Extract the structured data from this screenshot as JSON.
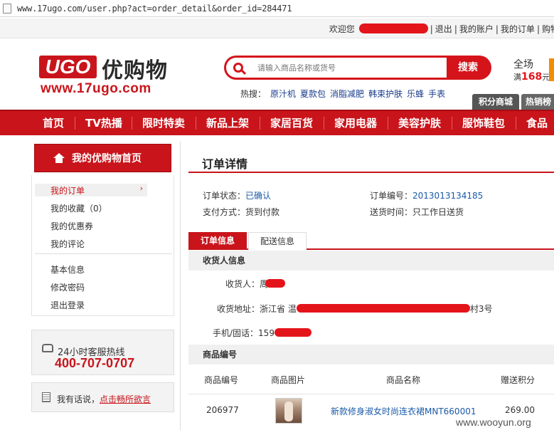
{
  "urlbar": {
    "url": "www.17ugo.com/user.php?act=order_detail&order_id=284471"
  },
  "topbar": {
    "welcome": "欢迎您",
    "logout": "退出",
    "account": "我的账户",
    "orders": "我的订单",
    "cart": "购物"
  },
  "header": {
    "logo_badge": "UGO",
    "logo_cn": "优购物",
    "logo_domain": "www.17ugo.com",
    "search_placeholder": "请输入商品名称或货号",
    "search_button": "搜索",
    "hot_label": "热搜：",
    "hot_terms": [
      "原汁机",
      "夏款包",
      "消脂减肥",
      "韩束护肤",
      "乐蜂",
      "手表"
    ],
    "promo_line1": "全场",
    "promo_line2_prefix": "满",
    "promo_amount": "168",
    "promo_line2_suffix": "元",
    "tab_points": "积分商城",
    "tab_hot": "热销榜"
  },
  "nav": [
    "首页",
    "TV热播",
    "限时特卖",
    "新品上架",
    "家居百货",
    "家用电器",
    "美容护肤",
    "服饰鞋包",
    "食品"
  ],
  "sidebar": {
    "home": "我的优购物首页",
    "menu": [
      {
        "label": "我的订单",
        "active": true
      },
      {
        "label": "我的收藏（0）"
      },
      {
        "label": "我的优惠券"
      },
      {
        "label": "我的评论"
      },
      {
        "label": "基本信息"
      },
      {
        "label": "修改密码"
      },
      {
        "label": "退出登录"
      }
    ],
    "hotline_title": "24小时客服热线",
    "hotline_number": "400-707-0707",
    "feedback_prefix": "我有话说，",
    "feedback_link": "点击畅所欲言"
  },
  "order": {
    "title": "订单详情",
    "status_label": "订单状态：",
    "status_value": "已确认",
    "number_label": "订单编号：",
    "number_value": "2013013134185",
    "payment_label": "支付方式：",
    "payment_value": "货到付款",
    "delivery_label": "送货时间：",
    "delivery_value": "只工作日送货",
    "tab_info": "订单信息",
    "tab_shipping": "配送信息",
    "receiver_section": "收货人信息",
    "receiver_label": "收货人：",
    "receiver_value": "周",
    "address_label": "收货地址：",
    "address_prefix": "浙江省 温",
    "address_suffix": "村3号",
    "phone_label": "手机/固话：",
    "phone_value": "159",
    "goods_section": "商品编号",
    "columns": [
      "商品编号",
      "商品图片",
      "商品名称",
      "赠送积分"
    ],
    "items": [
      {
        "code": "206977",
        "name": "新款修身淑女时尚连衣裙MNT660001",
        "points": "269.00"
      }
    ]
  },
  "watermark": "www.wooyun.org",
  "colors": {
    "brand_red": "#c9141b",
    "link_blue": "#1a5aa8",
    "promo_orange": "#f28c00"
  }
}
